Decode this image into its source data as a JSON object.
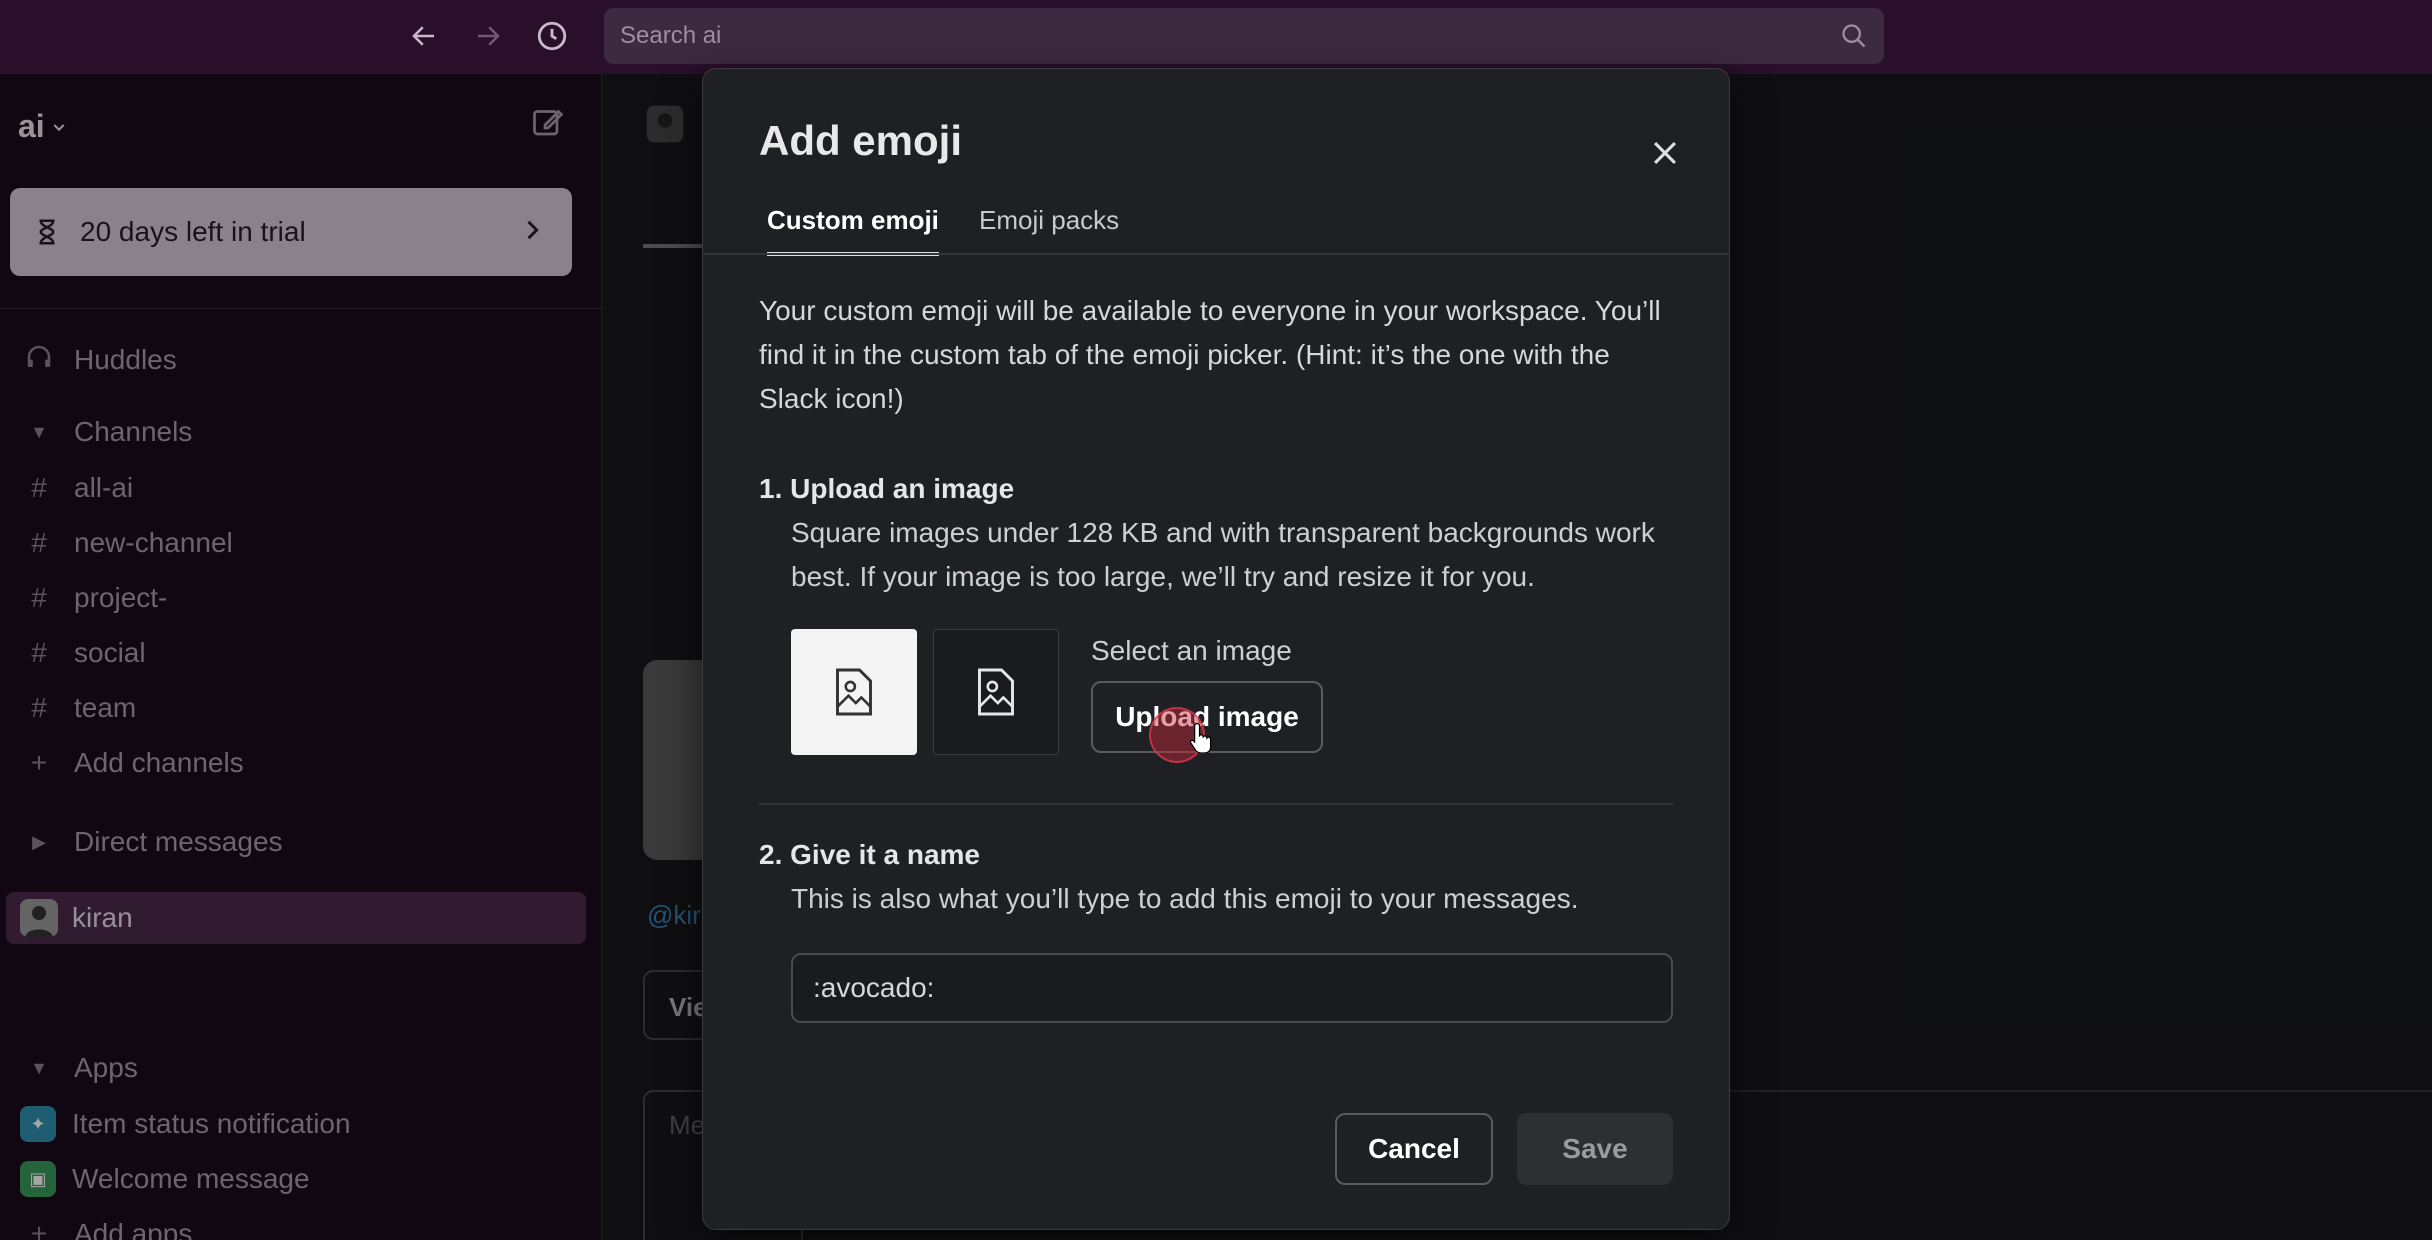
{
  "topbar": {
    "search_placeholder": "Search ai",
    "back_icon": "arrow-left-icon",
    "forward_icon": "arrow-right-icon",
    "history_icon": "clock-icon"
  },
  "sidebar": {
    "workspace_name": "ai",
    "trial_text": "20 days left in trial",
    "huddles": "Huddles",
    "channels_header": "Channels",
    "channels": [
      "all-ai",
      "new-channel",
      "project-",
      "social",
      "team"
    ],
    "add_channels": "Add channels",
    "dm_header": "Direct messages",
    "dm_user": "kiran",
    "apps_header": "Apps",
    "apps": [
      "Item status notification",
      "Welcome message"
    ],
    "add_apps": "Add apps"
  },
  "modal": {
    "title": "Add emoji",
    "tabs": [
      "Custom emoji",
      "Emoji packs"
    ],
    "intro": "Your custom emoji will be available to everyone in your workspace. You’ll find it in the custom tab of the emoji picker. (Hint: it’s the one with the Slack icon!)",
    "step1_title": "1. Upload an image",
    "step1_desc": "Square images under 128 KB and with transparent backgrounds work best. If your image is too large, we’ll try and resize it for you.",
    "select_label": "Select an image",
    "upload_button": "Upload image",
    "step2_title": "2. Give it a name",
    "step2_desc": "This is also what you’ll type to add this emoji to your messages.",
    "name_value": ":avocado:",
    "cancel_button": "Cancel",
    "save_button": "Save"
  },
  "background": {
    "mention_fragment": "@kir",
    "view_fragment": "Vie",
    "message_fragment": "Me"
  },
  "colors": {
    "topbar": "#2a0f2b",
    "sidebar": "#1b0b1c",
    "trial_banner": "#d6c7d8",
    "active_item": "#4a2a4c",
    "modal_bg": "#1f2023"
  }
}
